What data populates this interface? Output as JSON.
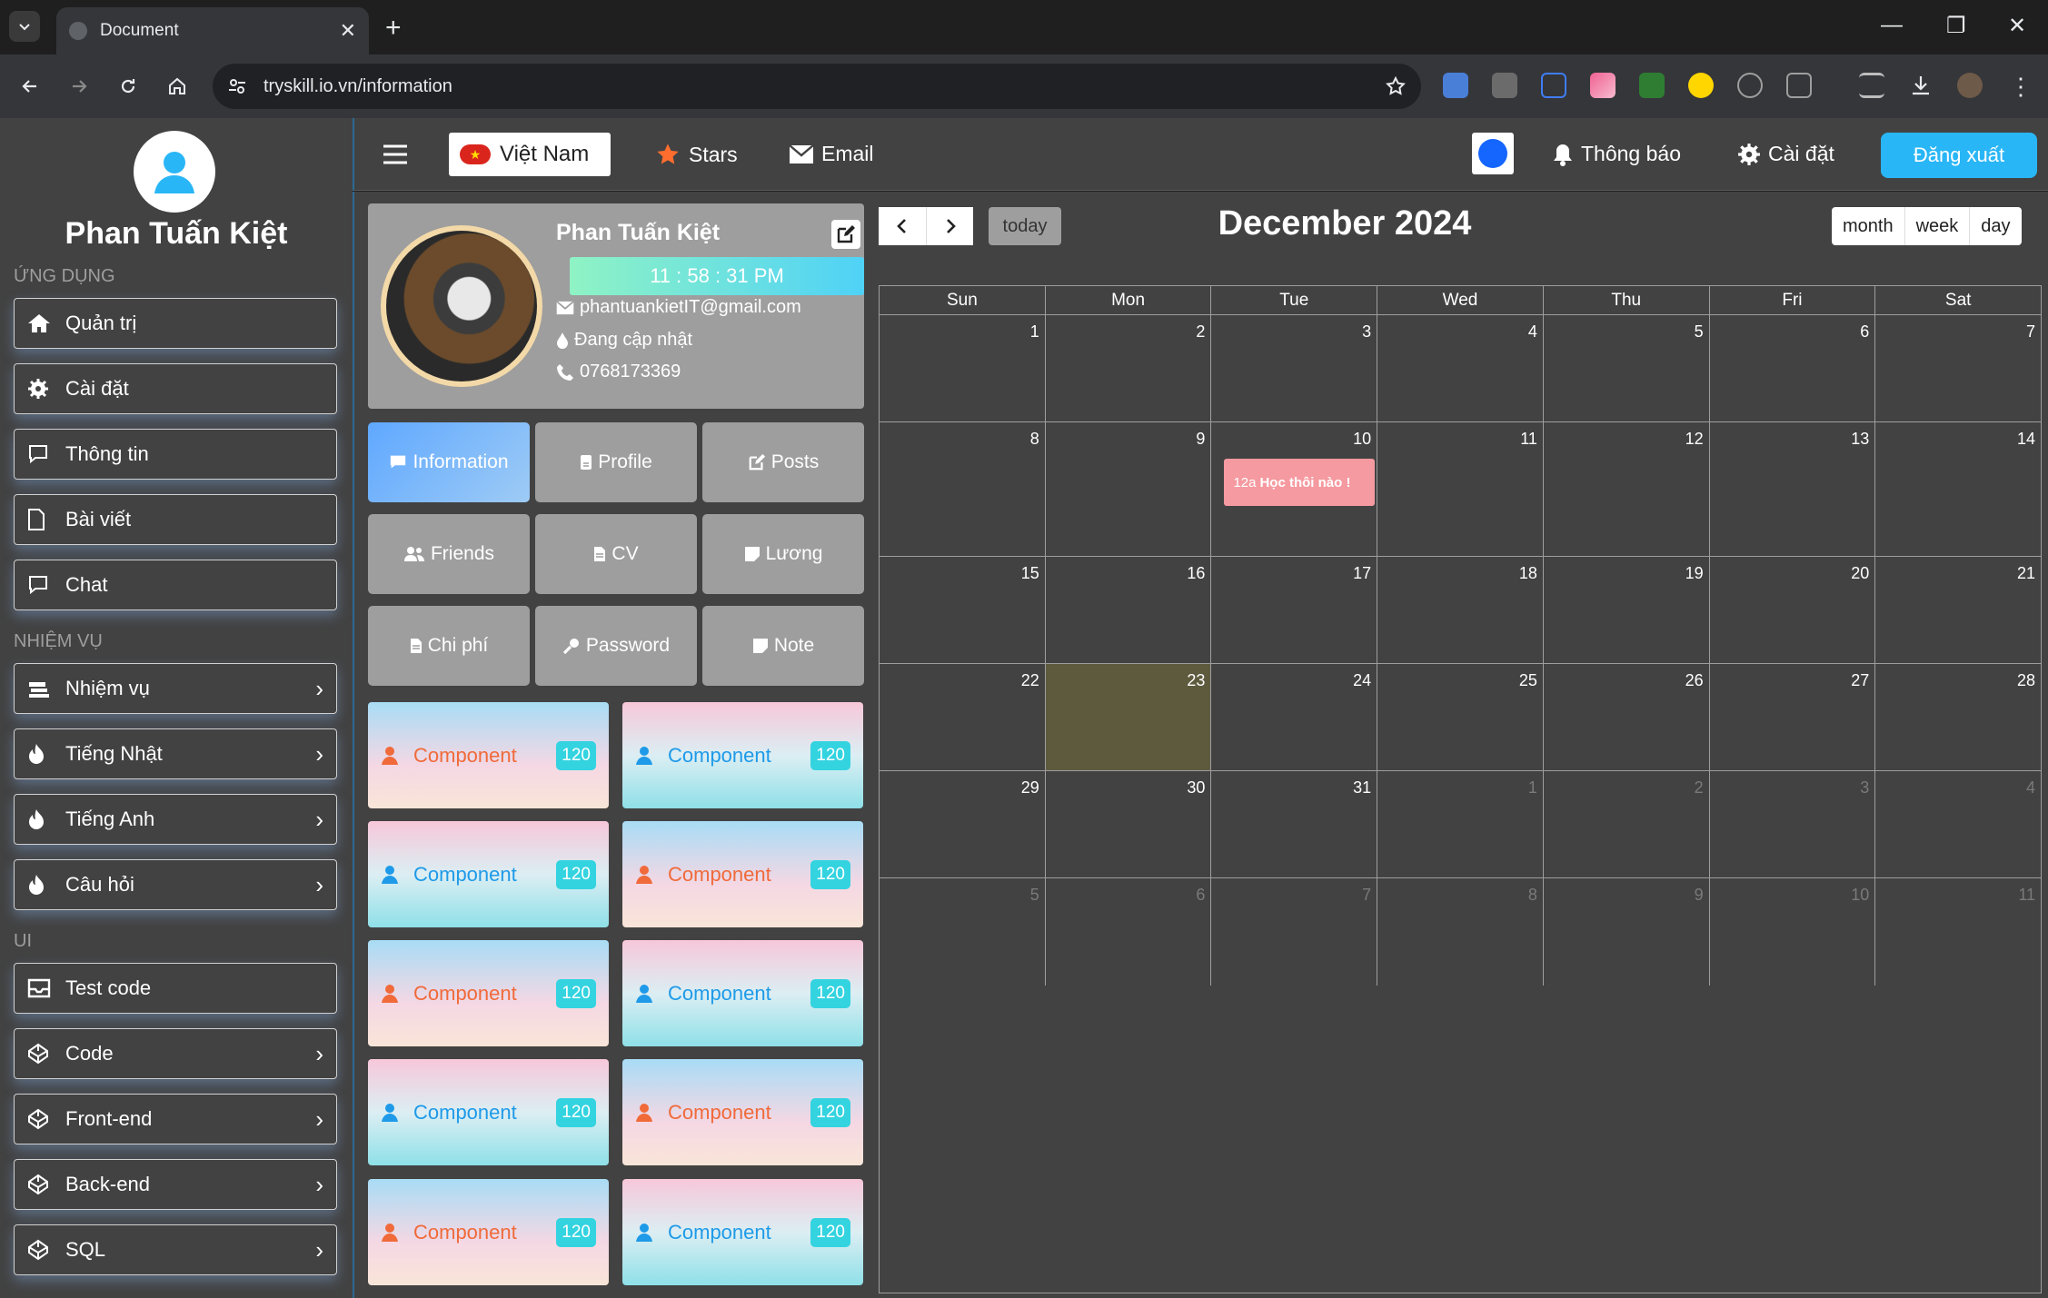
{
  "browser": {
    "tab_title": "Document",
    "url": "tryskill.io.vn/information"
  },
  "sidebar": {
    "user_name": "Phan Tuấn Kiệt",
    "sections": [
      "ỨNG DỤNG",
      "NHIỆM VỤ",
      "UI"
    ],
    "app_items": [
      {
        "label": "Quản trị",
        "icon": "home-icon"
      },
      {
        "label": "Cài đặt",
        "icon": "gear-icon"
      },
      {
        "label": "Thông tin",
        "icon": "comment-icon"
      },
      {
        "label": "Bài viết",
        "icon": "file-icon"
      },
      {
        "label": "Chat",
        "icon": "comment-icon"
      }
    ],
    "task_items": [
      {
        "label": "Nhiệm vụ",
        "icon": "layers-icon"
      },
      {
        "label": "Tiếng Nhật",
        "icon": "fire-icon"
      },
      {
        "label": "Tiếng Anh",
        "icon": "fire-icon"
      },
      {
        "label": "Câu hỏi",
        "icon": "fire-icon"
      }
    ],
    "ui_items": [
      {
        "label": "Test code",
        "icon": "inbox-icon"
      },
      {
        "label": "Code",
        "icon": "codepen-icon"
      },
      {
        "label": "Front-end",
        "icon": "codepen-icon"
      },
      {
        "label": "Back-end",
        "icon": "codepen-icon"
      },
      {
        "label": "SQL",
        "icon": "codepen-icon"
      }
    ]
  },
  "topnav": {
    "language": "Việt Nam",
    "stars": "Stars",
    "email": "Email",
    "notifications": "Thông báo",
    "settings": "Cài đặt",
    "logout": "Đăng xuất",
    "accent_color": "#1565ff"
  },
  "profile": {
    "name": "Phan Tuấn Kiệt",
    "clock": "11 : 58 : 31 PM",
    "email": "phantuankietIT@gmail.com",
    "status": "Đang cập nhật",
    "phone": "0768173369"
  },
  "profile_tabs": [
    {
      "label": "Information",
      "icon": "comment-icon"
    },
    {
      "label": "Profile",
      "icon": "id-card-icon"
    },
    {
      "label": "Posts",
      "icon": "edit-icon"
    },
    {
      "label": "Friends",
      "icon": "users-icon"
    },
    {
      "label": "CV",
      "icon": "file-icon"
    },
    {
      "label": "Lương",
      "icon": "note-icon"
    },
    {
      "label": "Chi phí",
      "icon": "file-icon"
    },
    {
      "label": "Password",
      "icon": "key-icon"
    },
    {
      "label": "Note",
      "icon": "note-icon"
    }
  ],
  "components": [
    {
      "label": "Component",
      "badge": "120"
    },
    {
      "label": "Component",
      "badge": "120"
    },
    {
      "label": "Component",
      "badge": "120"
    },
    {
      "label": "Component",
      "badge": "120"
    },
    {
      "label": "Component",
      "badge": "120"
    },
    {
      "label": "Component",
      "badge": "120"
    },
    {
      "label": "Component",
      "badge": "120"
    },
    {
      "label": "Component",
      "badge": "120"
    },
    {
      "label": "Component",
      "badge": "120"
    },
    {
      "label": "Component",
      "badge": "120"
    }
  ],
  "calendar": {
    "title": "December 2024",
    "today_label": "today",
    "views": [
      "month",
      "week",
      "day"
    ],
    "weekdays": [
      "Sun",
      "Mon",
      "Tue",
      "Wed",
      "Thu",
      "Fri",
      "Sat"
    ],
    "weeks": [
      [
        "1",
        "2",
        "3",
        "4",
        "5",
        "6",
        "7"
      ],
      [
        "8",
        "9",
        "10",
        "11",
        "12",
        "13",
        "14"
      ],
      [
        "15",
        "16",
        "17",
        "18",
        "19",
        "20",
        "21"
      ],
      [
        "22",
        "23",
        "24",
        "25",
        "26",
        "27",
        "28"
      ],
      [
        "29",
        "30",
        "31",
        "1",
        "2",
        "3",
        "4"
      ],
      [
        "5",
        "6",
        "7",
        "8",
        "9",
        "10",
        "11"
      ]
    ],
    "today_day": "23",
    "event": {
      "day": "10",
      "time": "12a",
      "title": "Học thôi nào !"
    }
  }
}
